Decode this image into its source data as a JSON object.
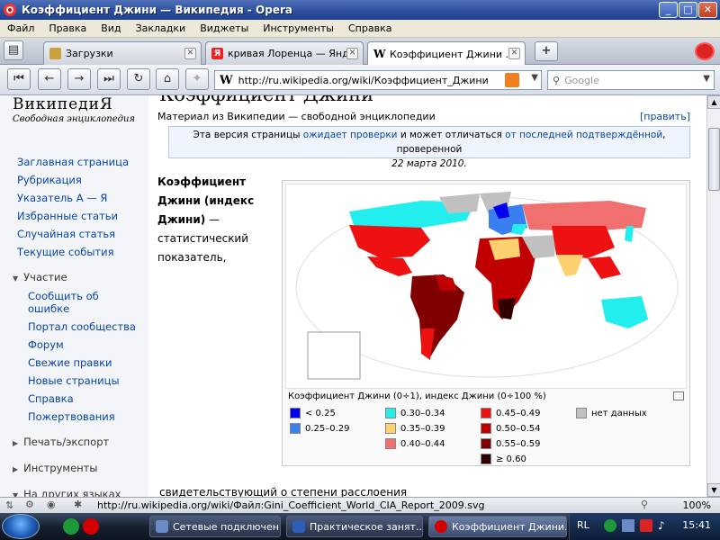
{
  "window": {
    "title": "Коэффициент Джини — Википедия - Opera"
  },
  "menu": [
    "Файл",
    "Правка",
    "Вид",
    "Закладки",
    "Виджеты",
    "Инструменты",
    "Справка"
  ],
  "tabs": [
    {
      "label": "Загрузки"
    },
    {
      "label": "кривая Лоренца — Янд..."
    },
    {
      "label": "Коэффициент Джини ..."
    }
  ],
  "address": {
    "url": "http://ru.wikipedia.org/wiki/Коэффициент_Джини",
    "search_placeholder": "Google"
  },
  "sidebar": {
    "logo": "ВикипедиЯ",
    "logo_sub": "Свободная энциклопедия",
    "nav": [
      "Заглавная страница",
      "Рубрикация",
      "Указатель А — Я",
      "Избранные статьи",
      "Случайная статья",
      "Текущие события"
    ],
    "participation_header": "Участие",
    "participation": [
      "Сообщить об",
      "ошибке",
      "Портал сообщества",
      "Форум",
      "Свежие правки",
      "Новые страницы",
      "Справка",
      "Пожертвования"
    ],
    "print_header": "Печать/экспорт",
    "tools_header": "Инструменты",
    "languages_header": "На других языках"
  },
  "article": {
    "heading_partial": "Коэффициент Джини",
    "from": "Материал из Википедии — свободной энциклопедии",
    "edit": "[править]",
    "notice_before": "Эта версия страницы ",
    "notice_link1": "ожидает проверки",
    "notice_mid": " и может отличаться ",
    "notice_link2": "от последней подтверждённой",
    "notice_after": ", проверенной",
    "notice_date": "22 марта 2010.",
    "intro_bold": "Коэффициент Джини (индекс Джини)",
    "intro_dash": " —",
    "intro_rest": "статистический показатель,",
    "caption": "Коэффициент Джини (0÷1), индекс Джини (0÷100 %)",
    "lower_text": "свидетельствующий о степени расслоения"
  },
  "legend": [
    {
      "label": "< 0.25",
      "color": "#0000ee"
    },
    {
      "label": "0.25–0.29",
      "color": "#3a7ff0"
    },
    {
      "label": "0.30–0.34",
      "color": "#22eeee"
    },
    {
      "label": "0.35–0.39",
      "color": "#ffd070"
    },
    {
      "label": "0.40–0.44",
      "color": "#f07070"
    },
    {
      "label": "0.45–0.49",
      "color": "#ee1111"
    },
    {
      "label": "0.50–0.54",
      "color": "#c00000"
    },
    {
      "label": "0.55–0.59",
      "color": "#800000"
    },
    {
      "label": "≥ 0.60",
      "color": "#300000"
    },
    {
      "label": "нет данных",
      "color": "#c0c0c0"
    }
  ],
  "status": {
    "url": "http://ru.wikipedia.org/wiki/Файл:Gini_Coefficient_World_CIA_Report_2009.svg",
    "zoom": "100%"
  },
  "taskbar": {
    "buttons": [
      "Сетевые подключения",
      "Практическое занят...",
      "Коэффициент Джини..."
    ],
    "lang": "RL",
    "time": "15:41"
  }
}
